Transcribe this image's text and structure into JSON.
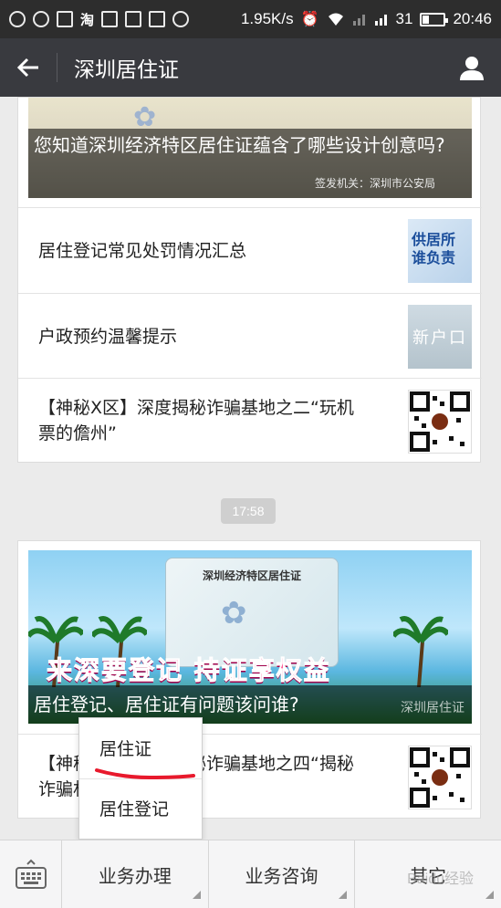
{
  "statusbar": {
    "icons": [
      "paw-icon",
      "qq-icon",
      "image-icon",
      "taobao-icon",
      "grid-icon",
      "lofter-icon",
      "lefeng-icon",
      "chat-icon"
    ],
    "taobao_glyph": "淘",
    "net_speed": "1.95K/s",
    "battery_level": "31",
    "battery_fill": 0.31,
    "time": "20:46"
  },
  "titlebar": {
    "title": "深圳居住证"
  },
  "card1": {
    "hero_caption": "您知道深圳经济特区居住证蕴含了哪些设计创意吗?",
    "hero_issuer": "签发机关：深圳市公安局",
    "rows": [
      {
        "title": "居住登记常见处罚情况汇总",
        "thumb_text": "供居所\n谁负责"
      },
      {
        "title": "户政预约温馨提示",
        "thumb_text": "新户口"
      },
      {
        "title": "【神秘X区】深度揭秘诈骗基地之二“玩机票的儋州”"
      }
    ]
  },
  "timestamp": "17:58",
  "card2": {
    "card_title": "深圳经济特区居住证",
    "slogan": "来深要登记 持证享权益",
    "hero_caption": "居住登记、居住证有问题该问谁?",
    "hero_mark": "深圳居住证",
    "row_title": "【神秘X区】深度揭秘诈骗基地之四“揭秘诈骗村”"
  },
  "popup": {
    "items": [
      "居住证",
      "居住登记"
    ],
    "highlight_color": "#e8192c"
  },
  "bottombar": {
    "tabs": [
      "业务办理",
      "业务咨询",
      "其它"
    ],
    "watermark": "Baidu经验"
  },
  "colors": {
    "titlebar": "#393a3f",
    "statusbar": "#2d2d2d",
    "background": "#ebebeb"
  }
}
